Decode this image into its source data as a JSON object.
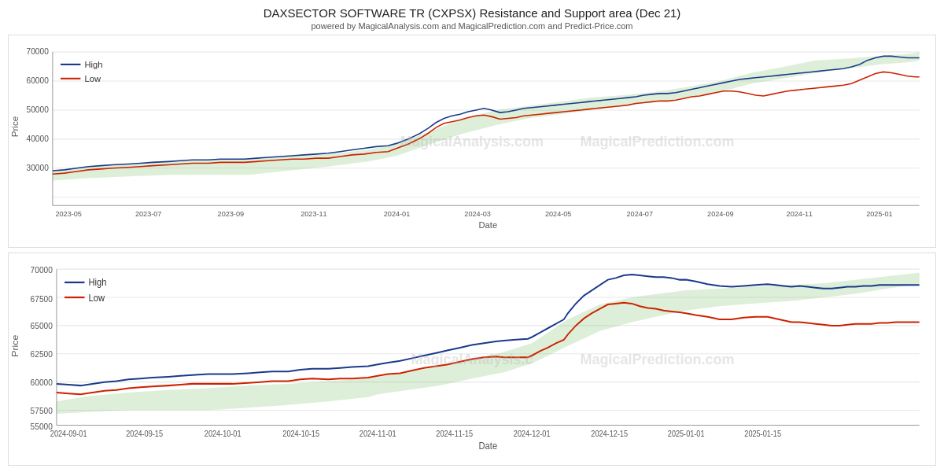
{
  "header": {
    "title": "DAXSECTOR SOFTWARE TR (CXPSX) Resistance and Support area (Dec 21)",
    "subtitle": "powered by MagicalAnalysis.com and MagicalPrediction.com and Predict-Price.com"
  },
  "legend": {
    "high_label": "High",
    "low_label": "Low"
  },
  "chart1": {
    "y_axis_label": "Price",
    "x_axis_label": "Date",
    "y_ticks": [
      "70000",
      "60000",
      "50000",
      "40000",
      "30000"
    ],
    "x_ticks": [
      "2023-05",
      "2023-07",
      "2023-09",
      "2023-11",
      "2024-01",
      "2024-03",
      "2024-05",
      "2024-07",
      "2024-09",
      "2024-11",
      "2025-01"
    ],
    "watermark1": "MagicalAnalysis.com",
    "watermark2": "MagicalPrediction.com"
  },
  "chart2": {
    "y_axis_label": "Price",
    "x_axis_label": "Date",
    "y_ticks": [
      "70000",
      "65000",
      "60000",
      "55000"
    ],
    "x_ticks": [
      "2024-09-01",
      "2024-09-15",
      "2024-10-01",
      "2024-10-15",
      "2024-11-01",
      "2024-11-15",
      "2024-12-01",
      "2024-12-15",
      "2025-01-01",
      "2025-01-15"
    ],
    "watermark1": "MagicalAnalysis.c",
    "watermark2": "MagicalPrediction.com"
  },
  "colors": {
    "high_line": "#1a3a8a",
    "low_line": "#cc2200",
    "band_fill": "rgba(100,180,80,0.25)",
    "band_stroke": "rgba(100,180,80,0.5)",
    "grid": "#e8e8e8",
    "axis": "#555"
  }
}
